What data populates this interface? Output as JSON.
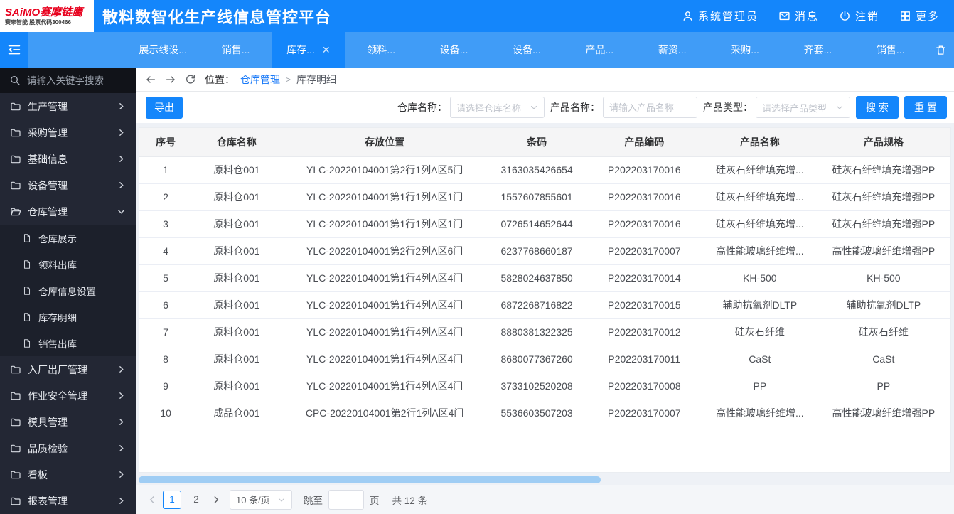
{
  "app": {
    "logo": {
      "line1": "SAiMO赛摩链鹰",
      "line2": "赛摩智能 股票代码300466"
    },
    "title": "散料数智化生产线信息管控平台",
    "user_menu": [
      {
        "name": "user",
        "icon": "person-icon",
        "label": "系统管理员"
      },
      {
        "name": "messages",
        "icon": "mail-icon",
        "label": "消息"
      },
      {
        "name": "logout",
        "icon": "logout-icon",
        "label": "注销"
      },
      {
        "name": "more",
        "icon": "grid-icon",
        "label": "更多"
      }
    ]
  },
  "tabbar": {
    "tabs": [
      {
        "label": "展示线设...",
        "active": false
      },
      {
        "label": "销售...",
        "active": false
      },
      {
        "label": "库存...",
        "active": true,
        "closable": true
      },
      {
        "label": "领料...",
        "active": false
      },
      {
        "label": "设备...",
        "active": false
      },
      {
        "label": "设备...",
        "active": false
      },
      {
        "label": "产品...",
        "active": false
      },
      {
        "label": "薪资...",
        "active": false
      },
      {
        "label": "采购...",
        "active": false
      },
      {
        "label": "齐套...",
        "active": false
      },
      {
        "label": "销售...",
        "active": false
      }
    ]
  },
  "sidebar": {
    "search_placeholder": "请输入关键字搜索",
    "items": [
      {
        "label": "生产管理",
        "expanded": false
      },
      {
        "label": "采购管理",
        "expanded": false
      },
      {
        "label": "基础信息",
        "expanded": false
      },
      {
        "label": "设备管理",
        "expanded": false
      },
      {
        "label": "仓库管理",
        "expanded": true,
        "children": [
          "仓库展示",
          "领料出库",
          "仓库信息设置",
          "库存明细",
          "销售出库"
        ]
      },
      {
        "label": "入厂出厂管理",
        "expanded": false
      },
      {
        "label": "作业安全管理",
        "expanded": false
      },
      {
        "label": "模具管理",
        "expanded": false
      },
      {
        "label": "品质检验",
        "expanded": false
      },
      {
        "label": "看板",
        "expanded": false
      },
      {
        "label": "报表管理",
        "expanded": false
      }
    ]
  },
  "breadcrumb": {
    "prefix": "位置：",
    "parent": "仓库管理",
    "separator": ">",
    "current": "库存明细"
  },
  "toolbar": {
    "export_label": "导出",
    "filters": [
      {
        "label": "仓库名称：",
        "placeholder": "请选择仓库名称",
        "type": "select"
      },
      {
        "label": "产品名称：",
        "placeholder": "请输入产品名称",
        "type": "input"
      },
      {
        "label": "产品类型：",
        "placeholder": "请选择产品类型",
        "type": "select"
      }
    ],
    "search_label": "搜索",
    "reset_label": "重置"
  },
  "table": {
    "columns": [
      "序号",
      "仓库名称",
      "存放位置",
      "条码",
      "产品编码",
      "产品名称",
      "产品规格"
    ],
    "rows": [
      [
        "1",
        "原料仓001",
        "YLC-20220104001第2行1列A区5门",
        "3163035426654",
        "P202203170016",
        "硅灰石纤维填充增...",
        "硅灰石纤维填充增强PP"
      ],
      [
        "2",
        "原料仓001",
        "YLC-20220104001第1行1列A区1门",
        "1557607855601",
        "P202203170016",
        "硅灰石纤维填充增...",
        "硅灰石纤维填充增强PP"
      ],
      [
        "3",
        "原料仓001",
        "YLC-20220104001第1行1列A区1门",
        "0726514652644",
        "P202203170016",
        "硅灰石纤维填充增...",
        "硅灰石纤维填充增强PP"
      ],
      [
        "4",
        "原料仓001",
        "YLC-20220104001第2行2列A区6门",
        "6237768660187",
        "P202203170007",
        "高性能玻璃纤维增...",
        "高性能玻璃纤维增强PP"
      ],
      [
        "5",
        "原料仓001",
        "YLC-20220104001第1行4列A区4门",
        "5828024637850",
        "P202203170014",
        "KH-500",
        "KH-500"
      ],
      [
        "6",
        "原料仓001",
        "YLC-20220104001第1行4列A区4门",
        "6872268716822",
        "P202203170015",
        "辅助抗氧剂DLTP",
        "辅助抗氧剂DLTP"
      ],
      [
        "7",
        "原料仓001",
        "YLC-20220104001第1行4列A区4门",
        "8880381322325",
        "P202203170012",
        "硅灰石纤维",
        "硅灰石纤维"
      ],
      [
        "8",
        "原料仓001",
        "YLC-20220104001第1行4列A区4门",
        "8680077367260",
        "P202203170011",
        "CaSt",
        "CaSt"
      ],
      [
        "9",
        "原料仓001",
        "YLC-20220104001第1行4列A区4门",
        "3733102520208",
        "P202203170008",
        "PP",
        "PP"
      ],
      [
        "10",
        "成品仓001",
        "CPC-20220104001第2行1列A区4门",
        "5536603507203",
        "P202203170007",
        "高性能玻璃纤维增...",
        "高性能玻璃纤维增强PP"
      ]
    ]
  },
  "pagination": {
    "pages": [
      "1",
      "2"
    ],
    "active_page": "1",
    "page_size": "10 条/页",
    "jump_label": "跳至",
    "jump_value": "",
    "jump_suffix": "页",
    "total": "共 12 条"
  },
  "colors": {
    "accent": "#1486fb",
    "tabbar": "#409cf7",
    "sidebar_bg": "#232734",
    "link": "#1a7af8",
    "scroll_thumb": "#9fcdf4"
  }
}
